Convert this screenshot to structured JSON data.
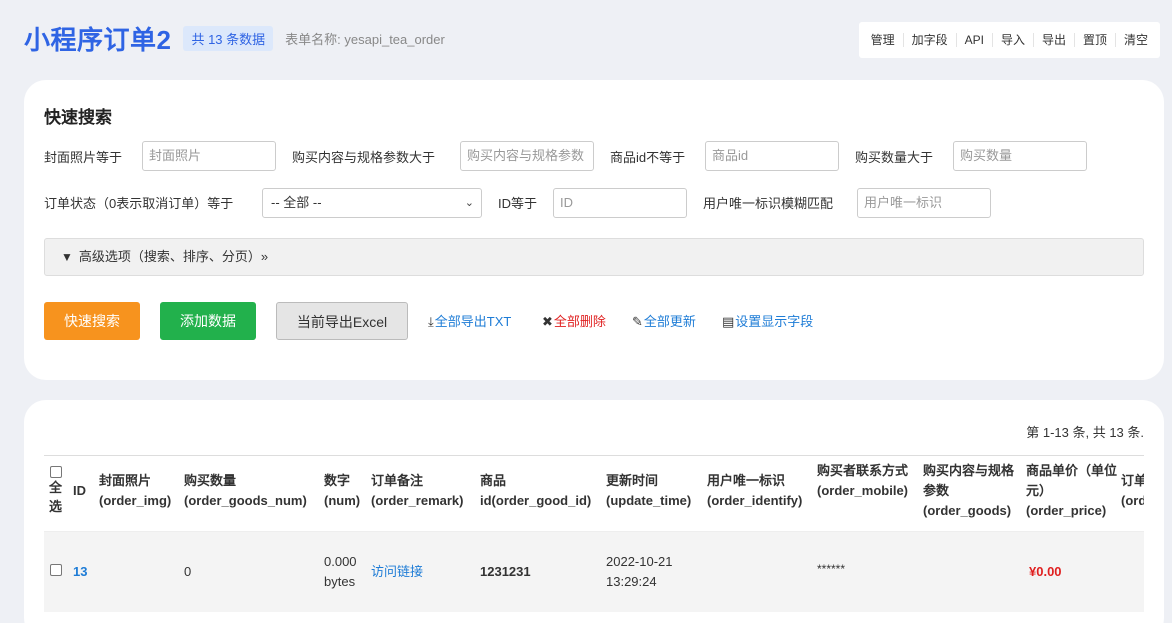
{
  "header": {
    "title": "小程序订单2",
    "count_badge": "共 13 条数据",
    "form_name": "表单名称: yesapi_tea_order"
  },
  "top_actions": [
    "管理",
    "加字段",
    "API",
    "导入",
    "导出",
    "置顶",
    "清空"
  ],
  "search": {
    "title": "快速搜索",
    "fields": {
      "cover_label": "封面照片等于",
      "cover_placeholder": "封面照片",
      "goods_label": "购买内容与规格参数大于",
      "goods_placeholder": "购买内容与规格参数",
      "goodid_label": "商品id不等于",
      "goodid_placeholder": "商品id",
      "num_label": "购买数量大于",
      "num_placeholder": "购买数量",
      "status_label": "订单状态（0表示取消订单）等于",
      "status_value": "-- 全部 --",
      "id_label": "ID等于",
      "id_placeholder": "ID",
      "identify_label": "用户唯一标识模糊匹配",
      "identify_placeholder": "用户唯一标识"
    },
    "advanced": "高级选项（搜索、排序、分页）»",
    "buttons": {
      "quick_search": "快速搜索",
      "add_data": "添加数据",
      "export_excel": "当前导出Excel"
    },
    "links": {
      "export_txt": "全部导出TXT",
      "delete_all": "全部删除",
      "update_all": "全部更新",
      "display_fields": "设置显示字段"
    }
  },
  "table": {
    "pager": "第 1-13 条, 共 13 条.",
    "select_all": "全选",
    "columns": [
      {
        "title": "ID",
        "sub": ""
      },
      {
        "title": "封面照片",
        "sub": "(order_img)"
      },
      {
        "title": "购买数量",
        "sub": "(order_goods_num)"
      },
      {
        "title": "数字",
        "sub": "(num)"
      },
      {
        "title": "订单备注",
        "sub": "(order_remark)"
      },
      {
        "title": "商品",
        "sub": "id(order_good_id)"
      },
      {
        "title": "更新时间",
        "sub": "(update_time)"
      },
      {
        "title": "用户唯一标识",
        "sub": "(order_identify)"
      },
      {
        "title": "购买者联系方式",
        "sub": "(order_mobile)"
      },
      {
        "title": "购买内容与规格参数",
        "sub": "(order_goods)"
      },
      {
        "title": "商品单价（单位元）",
        "sub": "(order_price)"
      },
      {
        "title": "订单",
        "sub": "(ord"
      }
    ],
    "rows": [
      {
        "id": "13",
        "order_goods_num": "0",
        "num_line1": "0.000",
        "num_line2": "bytes",
        "remark": "访问链接",
        "good_id": "1231231",
        "date": "2022-10-21",
        "time": "13:29:24",
        "mobile": "******",
        "price": "¥0.00"
      }
    ]
  },
  "colors": {
    "primary": "#2f64e4",
    "orange": "#f7931e",
    "green": "#22b14c",
    "link": "#1e7cd6",
    "danger": "#e02020"
  }
}
